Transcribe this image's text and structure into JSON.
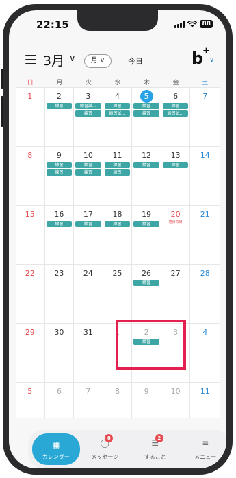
{
  "status": {
    "time": "22:15",
    "battery": "88"
  },
  "header": {
    "month": "3月",
    "month_caret": "∨",
    "view": "月 ∨",
    "today": "今日",
    "logo": "b",
    "logo_plus": "+",
    "logo_caret": "∨"
  },
  "weekdays": [
    "日",
    "月",
    "火",
    "水",
    "木",
    "金",
    "土"
  ],
  "weeks": [
    [
      {
        "day": "1",
        "type": "sun",
        "events": []
      },
      {
        "day": "2",
        "type": "",
        "events": [
          "練習"
        ]
      },
      {
        "day": "3",
        "type": "",
        "events": [
          "練習試…",
          "練習"
        ]
      },
      {
        "day": "4",
        "type": "",
        "events": [
          "練習",
          "練習試…"
        ]
      },
      {
        "day": "5",
        "type": "today",
        "events": [
          "練習",
          "練習"
        ]
      },
      {
        "day": "6",
        "type": "",
        "events": [
          "練習",
          "練習試…"
        ]
      },
      {
        "day": "7",
        "type": "sat",
        "events": []
      }
    ],
    [
      {
        "day": "8",
        "type": "sun",
        "events": []
      },
      {
        "day": "9",
        "type": "",
        "events": [
          "練習",
          "練習"
        ]
      },
      {
        "day": "10",
        "type": "",
        "events": [
          "練習",
          "練習"
        ]
      },
      {
        "day": "11",
        "type": "",
        "events": [
          "練習",
          "練習"
        ]
      },
      {
        "day": "12",
        "type": "",
        "events": [
          "練習"
        ]
      },
      {
        "day": "13",
        "type": "",
        "events": [
          "練習"
        ]
      },
      {
        "day": "14",
        "type": "sat",
        "events": []
      }
    ],
    [
      {
        "day": "15",
        "type": "sun",
        "events": []
      },
      {
        "day": "16",
        "type": "",
        "events": [
          "練習"
        ]
      },
      {
        "day": "17",
        "type": "",
        "events": [
          "練習"
        ]
      },
      {
        "day": "18",
        "type": "",
        "events": [
          "練習"
        ]
      },
      {
        "day": "19",
        "type": "",
        "events": [
          "練習"
        ]
      },
      {
        "day": "20",
        "type": "sun",
        "holiday": "春分の日",
        "events": []
      },
      {
        "day": "21",
        "type": "sat",
        "events": []
      }
    ],
    [
      {
        "day": "22",
        "type": "sun",
        "events": []
      },
      {
        "day": "23",
        "type": "",
        "events": []
      },
      {
        "day": "24",
        "type": "",
        "events": []
      },
      {
        "day": "25",
        "type": "",
        "events": []
      },
      {
        "day": "26",
        "type": "",
        "events": [
          "練習"
        ]
      },
      {
        "day": "27",
        "type": "",
        "events": []
      },
      {
        "day": "28",
        "type": "sat",
        "events": []
      }
    ],
    [
      {
        "day": "29",
        "type": "sun",
        "events": []
      },
      {
        "day": "30",
        "type": "",
        "events": []
      },
      {
        "day": "31",
        "type": "",
        "events": []
      },
      {
        "day": "1",
        "type": "other",
        "events": []
      },
      {
        "day": "2",
        "type": "other",
        "events": [
          "練習"
        ]
      },
      {
        "day": "3",
        "type": "other",
        "events": []
      },
      {
        "day": "4",
        "type": "sat",
        "events": []
      }
    ],
    [
      {
        "day": "5",
        "type": "sun",
        "events": []
      },
      {
        "day": "6",
        "type": "other",
        "events": []
      },
      {
        "day": "7",
        "type": "other",
        "events": []
      },
      {
        "day": "8",
        "type": "other",
        "events": []
      },
      {
        "day": "9",
        "type": "other",
        "events": []
      },
      {
        "day": "10",
        "type": "other",
        "events": []
      },
      {
        "day": "11",
        "type": "sat",
        "events": []
      }
    ]
  ],
  "tabs": [
    {
      "id": "calendar",
      "label": "カレンダー",
      "icon": "calendar-icon",
      "active": true
    },
    {
      "id": "messages",
      "label": "メッセージ",
      "icon": "chat-bubble-icon",
      "badge": "8"
    },
    {
      "id": "todo",
      "label": "すること",
      "icon": "checklist-icon",
      "badge": "2"
    },
    {
      "id": "menu",
      "label": "メニュー",
      "icon": "hamburger-icon"
    }
  ],
  "colors": {
    "accent": "#29a8d6",
    "event": "#3ea6a4",
    "sunday": "#e5484d",
    "saturday": "#2a8bd6",
    "highlight": "#e3204f"
  }
}
